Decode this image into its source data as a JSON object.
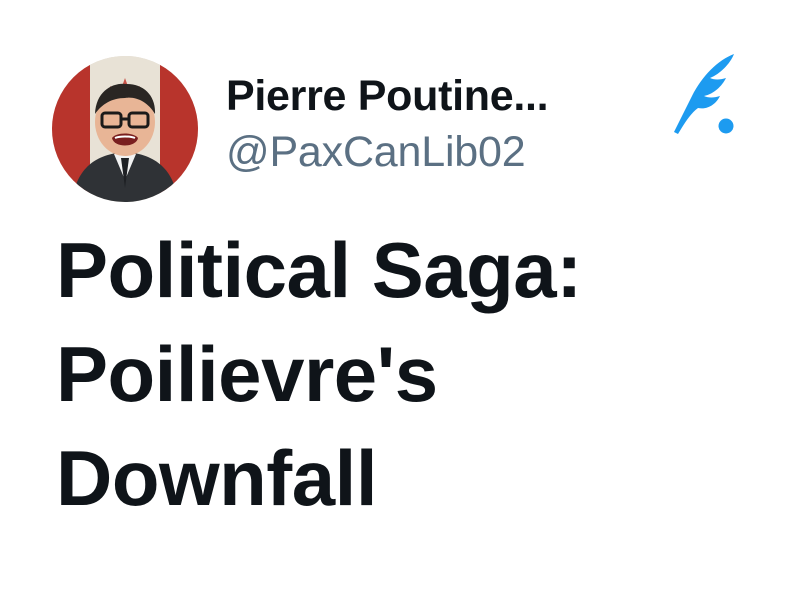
{
  "author": {
    "display_name": "Pierre Poutine...",
    "handle": "@PaxCanLib02",
    "avatar_icon": "avatar-crying-child-flag"
  },
  "brand": {
    "icon": "quill-feather-icon",
    "color": "#1d9bf0"
  },
  "tweet": {
    "lines": [
      "Political Saga:",
      "Poilievre's",
      "Downfall"
    ]
  },
  "colors": {
    "text_primary": "#0f1419",
    "text_secondary": "#5b7083",
    "background": "#ffffff",
    "accent": "#1d9bf0"
  }
}
